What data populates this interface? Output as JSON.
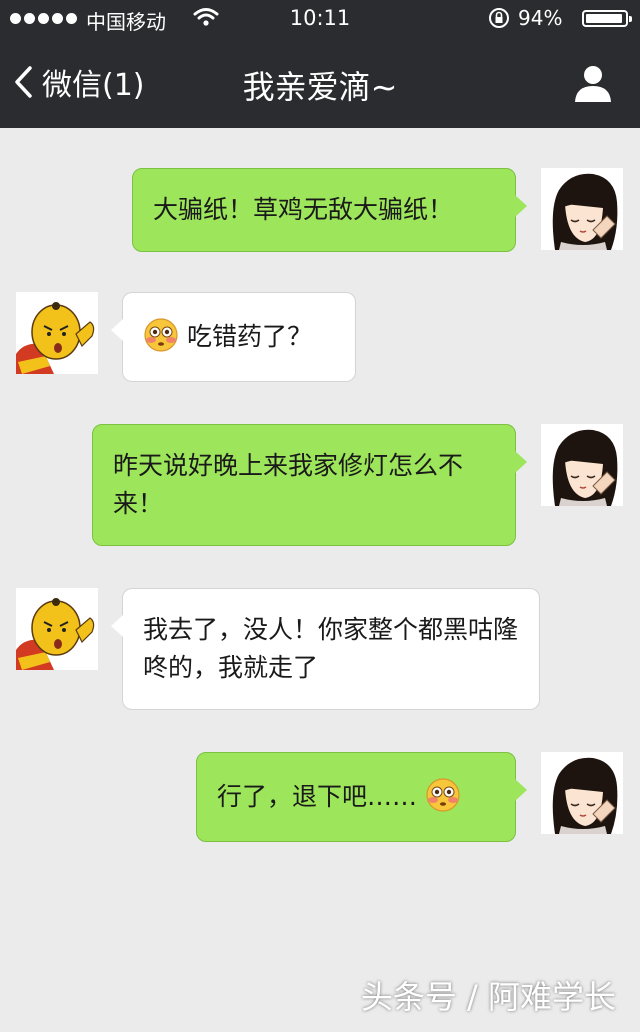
{
  "status_bar": {
    "carrier": "中国移动",
    "time": "10:11",
    "battery_percent": "94%",
    "battery_level": 0.94,
    "icons": [
      "signal-dots-icon",
      "wifi-icon",
      "rotation-lock-icon",
      "battery-icon"
    ]
  },
  "nav": {
    "back_label": "微信(1)",
    "title": "我亲爱滴~",
    "right_icon": "person-icon",
    "bar_color": "#2b2c30"
  },
  "colors": {
    "background": "#ebebeb",
    "outgoing_bubble": "#9de55a",
    "incoming_bubble": "#ffffff"
  },
  "messages": [
    {
      "side": "out",
      "text": "大骗纸！草鸡无敌大骗纸！",
      "avatar": "girl-avatar"
    },
    {
      "side": "in",
      "text": "吃错药了？",
      "emoji": "flushed-face-emoji",
      "avatar": "boy-avatar"
    },
    {
      "side": "out",
      "text": "昨天说好晚上来我家修灯怎么不来！",
      "avatar": "girl-avatar"
    },
    {
      "side": "in",
      "text": "我去了，没人！你家整个都黑咕隆咚的，我就走了",
      "avatar": "boy-avatar"
    },
    {
      "side": "out",
      "text": "行了，退下吧……",
      "emoji": "flushed-face-emoji",
      "avatar": "girl-avatar"
    }
  ],
  "watermark": "头条号 / 阿难学长"
}
